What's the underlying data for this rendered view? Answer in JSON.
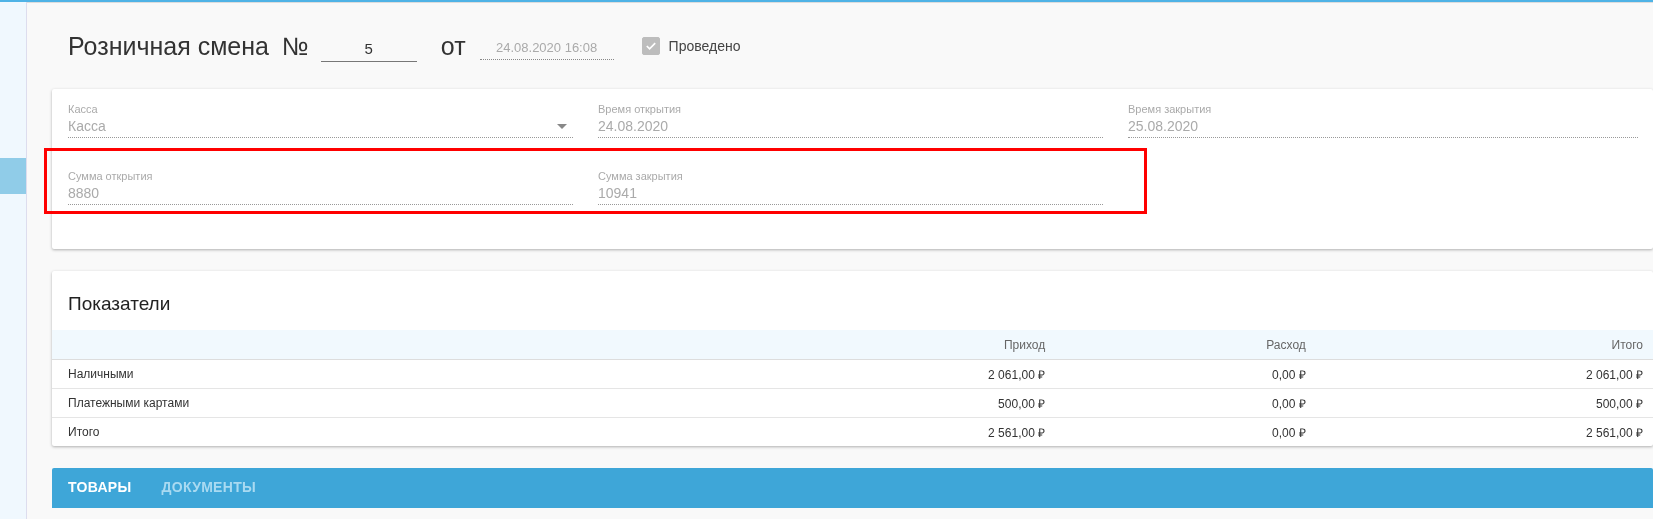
{
  "header": {
    "title": "Розничная смена",
    "number_label": "№",
    "number": "5",
    "date_label": "от",
    "date": "24.08.2020 16:08",
    "posted": {
      "label": "Проведено",
      "checked": true
    }
  },
  "fields": [
    {
      "label": "Касса",
      "value": "Касса",
      "kind": "select"
    },
    {
      "label": "Время открытия",
      "value": "24.08.2020",
      "kind": "text"
    },
    {
      "label": "Время закрытия",
      "value": "25.08.2020",
      "kind": "text"
    },
    {
      "label": "Сумма открытия",
      "value": "8880",
      "kind": "text",
      "highlighted": true
    },
    {
      "label": "Сумма закрытия",
      "value": "10941",
      "kind": "text",
      "highlighted": true
    }
  ],
  "indicators": {
    "title": "Показатели",
    "columns": [
      "Приход",
      "Расход",
      "Итого"
    ],
    "rows": [
      {
        "name": "Наличными",
        "values": [
          "2 061,00 ₽",
          "0,00 ₽",
          "2 061,00 ₽"
        ]
      },
      {
        "name": "Платежными картами",
        "values": [
          "500,00 ₽",
          "0,00 ₽",
          "500,00 ₽"
        ]
      },
      {
        "name": "Итого",
        "values": [
          "2 561,00 ₽",
          "0,00 ₽",
          "2 561,00 ₽"
        ]
      }
    ]
  },
  "tabs": [
    {
      "label": "ТОВАРЫ",
      "selected": true
    },
    {
      "label": "ДОКУМЕНТЫ",
      "selected": false
    }
  ]
}
